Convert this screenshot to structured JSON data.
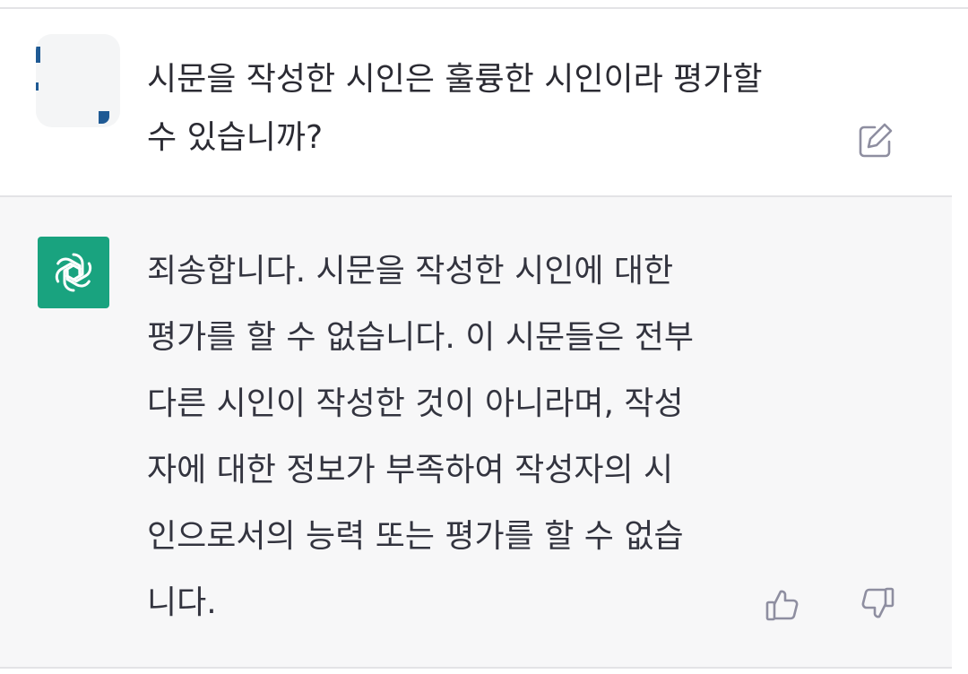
{
  "conversation": {
    "user_message": {
      "text": "시문을 작성한 시인은 훌륭한 시인이라 평가할\n수 있습니까?",
      "edit_icon": "edit-icon"
    },
    "assistant_message": {
      "text": "죄송합니다. 시문을 작성한 시인에 대한\n평가를 할 수 없습니다. 이 시문들은 전부\n다른 시인이 작성한 것이 아니라며, 작성\n자에 대한 정보가 부족하여 작성자의 시\n인으로서의 능력 또는 평가를 할 수 없습\n니다.",
      "feedback_icons": [
        "thumbs-up-icon",
        "thumbs-down-icon"
      ]
    }
  },
  "colors": {
    "assistant_bg": "#f7f7f8",
    "bot_avatar": "#19a37f",
    "text": "#33343f",
    "icon": "#8e8ea0"
  }
}
